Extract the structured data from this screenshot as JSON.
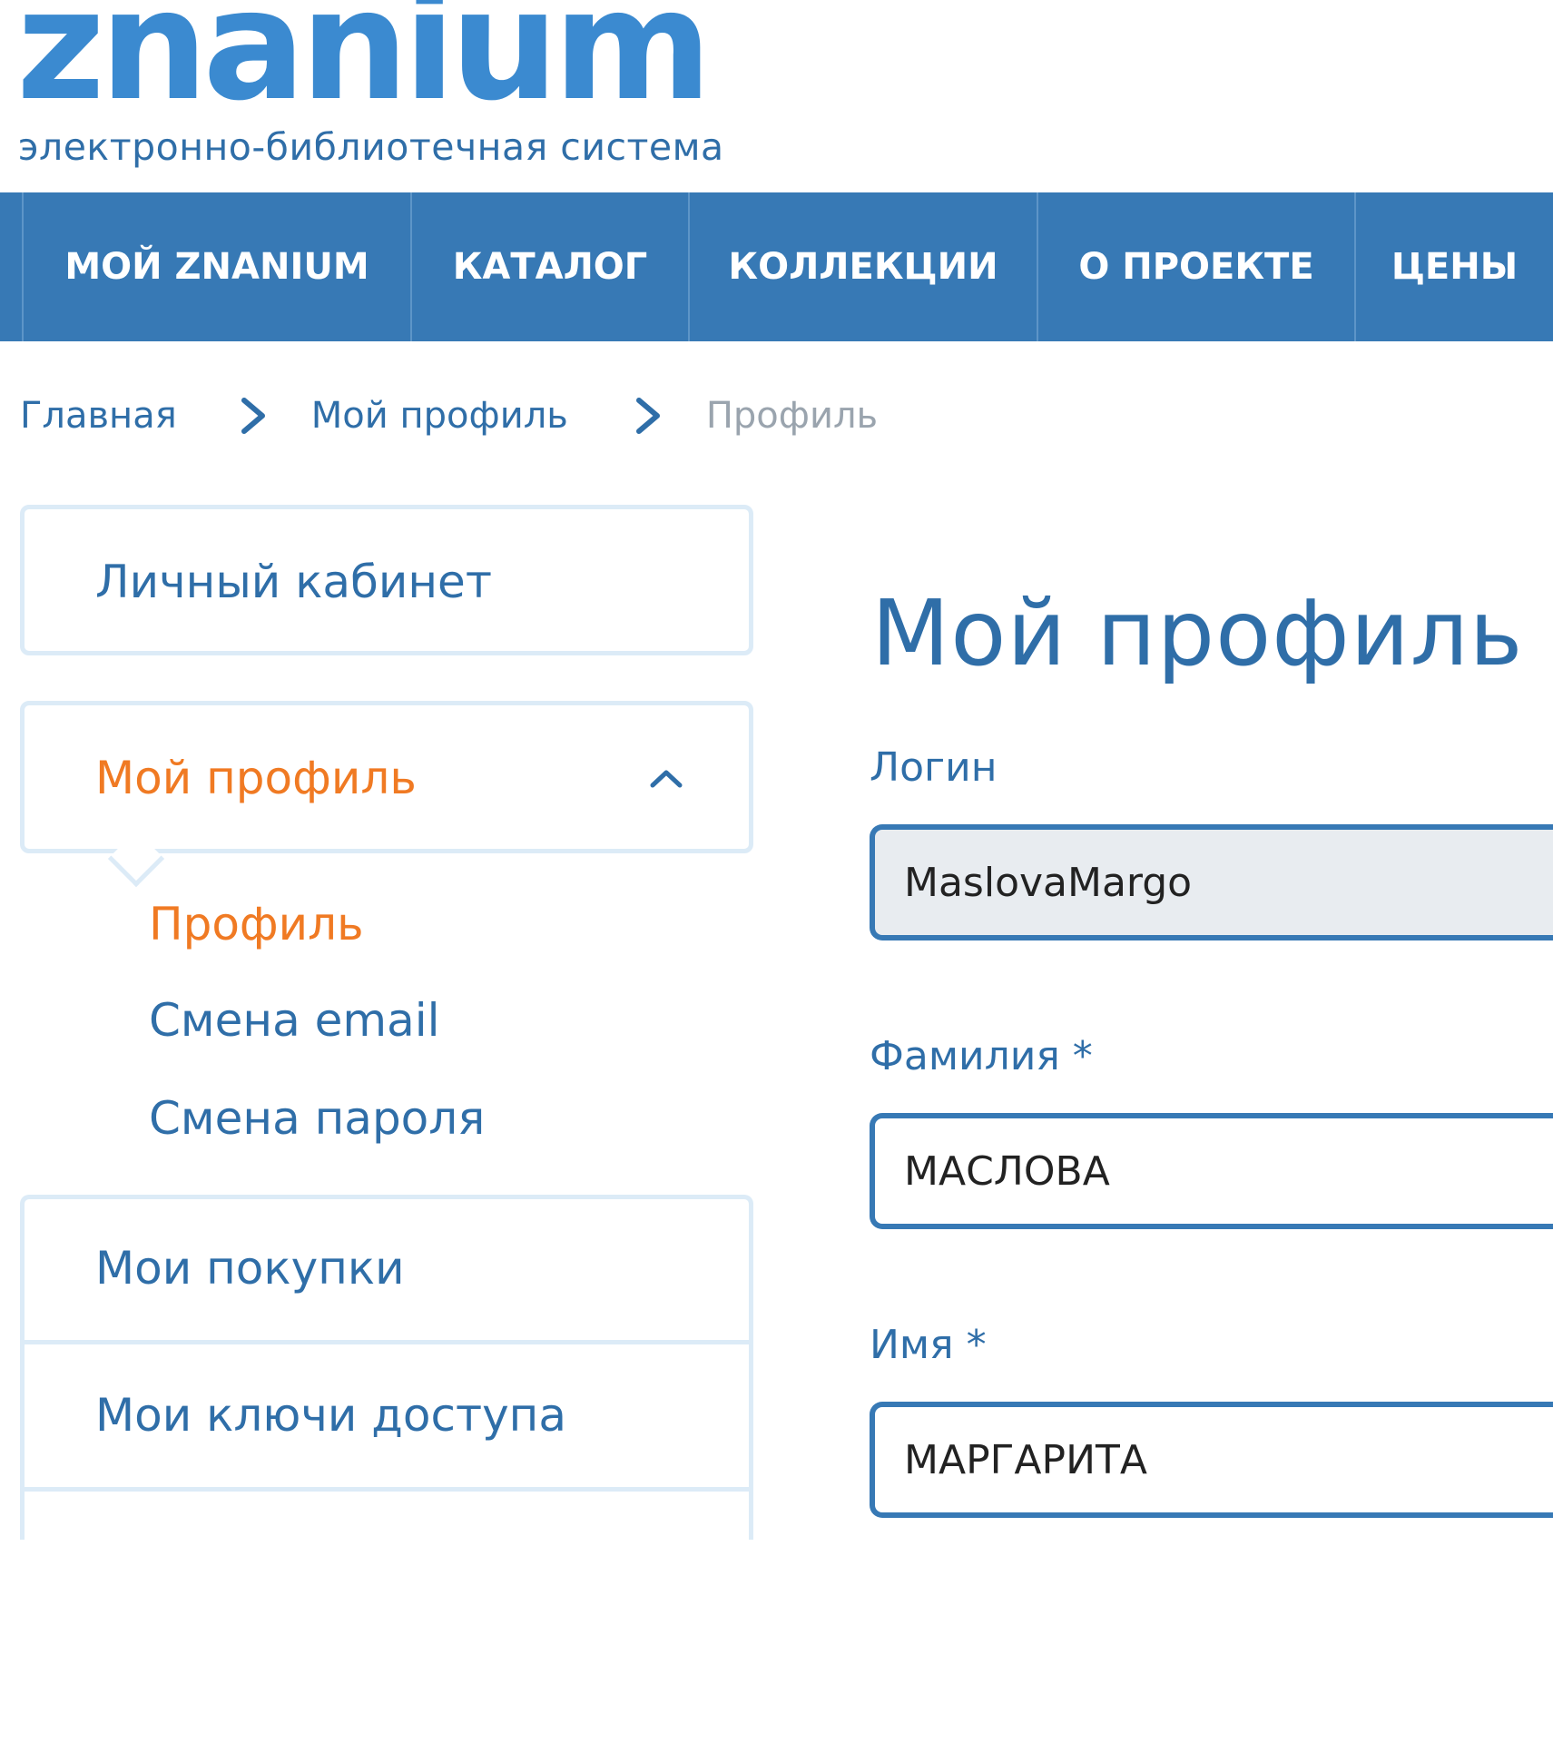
{
  "logo": {
    "wordmark": "znanium",
    "subtitle": "электронно-библиотечная система"
  },
  "nav": {
    "items": [
      {
        "label": "МОЙ ZNANIUM"
      },
      {
        "label": "КАТАЛОГ"
      },
      {
        "label": "КОЛЛЕКЦИИ"
      },
      {
        "label": "О ПРОЕКТЕ"
      },
      {
        "label": "ЦЕНЫ"
      }
    ]
  },
  "breadcrumb": {
    "items": [
      "Главная",
      "Мой профиль",
      "Профиль"
    ]
  },
  "sidebar": {
    "cabinet": "Личный кабинет",
    "profile_section": "Мой профиль",
    "submenu": [
      "Профиль",
      "Смена email",
      "Смена пароля"
    ],
    "list": [
      "Мои покупки",
      "Мои ключи доступа"
    ]
  },
  "main": {
    "title": "Мой профиль",
    "fields": {
      "login": {
        "label": "Логин",
        "value": "MaslovaMargo"
      },
      "surname": {
        "label": "Фамилия  *",
        "value": "МАСЛОВА"
      },
      "name": {
        "label": "Имя  *",
        "value": "МАРГАРИТА"
      }
    }
  },
  "colors": {
    "brand_blue": "#3b8ad0",
    "nav_blue": "#3779b5",
    "text_blue": "#2f6ea8",
    "accent_orange": "#f07a23",
    "border_light": "#dcebf7"
  }
}
